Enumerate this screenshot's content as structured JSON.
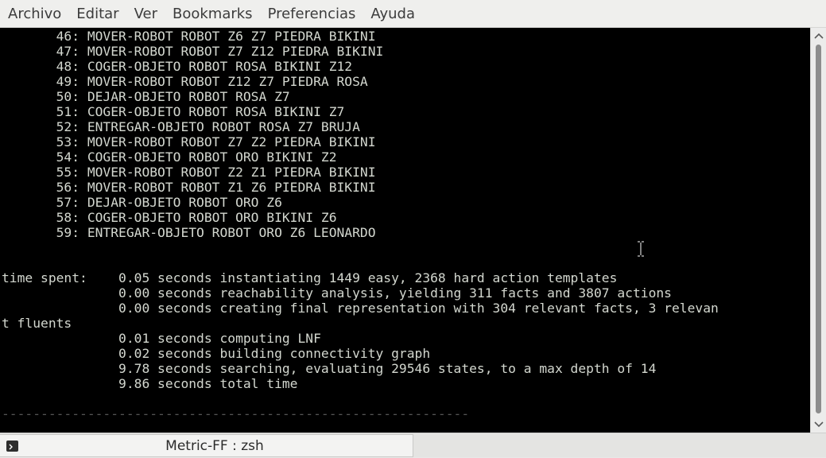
{
  "menubar": {
    "items": [
      "Archivo",
      "Editar",
      "Ver",
      "Bookmarks",
      "Preferencias",
      "Ayuda"
    ]
  },
  "terminal": {
    "lines": [
      "       46: MOVER-ROBOT ROBOT Z6 Z7 PIEDRA BIKINI",
      "       47: MOVER-ROBOT ROBOT Z7 Z12 PIEDRA BIKINI",
      "       48: COGER-OBJETO ROBOT ROSA BIKINI Z12",
      "       49: MOVER-ROBOT ROBOT Z12 Z7 PIEDRA ROSA",
      "       50: DEJAR-OBJETO ROBOT ROSA Z7",
      "       51: COGER-OBJETO ROBOT ROSA BIKINI Z7",
      "       52: ENTREGAR-OBJETO ROBOT ROSA Z7 BRUJA",
      "       53: MOVER-ROBOT ROBOT Z7 Z2 PIEDRA BIKINI",
      "       54: COGER-OBJETO ROBOT ORO BIKINI Z2",
      "       55: MOVER-ROBOT ROBOT Z2 Z1 PIEDRA BIKINI",
      "       56: MOVER-ROBOT ROBOT Z1 Z6 PIEDRA BIKINI",
      "       57: DEJAR-OBJETO ROBOT ORO Z6",
      "       58: COGER-OBJETO ROBOT ORO BIKINI Z6",
      "       59: ENTREGAR-OBJETO ROBOT ORO Z6 LEONARDO",
      "",
      "",
      "time spent:    0.05 seconds instantiating 1449 easy, 2368 hard action templates",
      "               0.00 seconds reachability analysis, yielding 311 facts and 3807 actions",
      "               0.00 seconds creating final representation with 304 relevant facts, 3 relevan",
      "t fluents",
      "               0.01 seconds computing LNF",
      "               0.02 seconds building connectivity graph",
      "               9.78 seconds searching, evaluating 29546 states, to a max depth of 14",
      "               9.86 seconds total time",
      "",
      "------------------------------------------------------------"
    ]
  },
  "tab": {
    "icon": "terminal-icon",
    "label": "Metric-FF : zsh"
  },
  "colors": {
    "terminal_bg": "#000000",
    "terminal_fg": "#d3d7cf",
    "dashes": "#555555"
  }
}
